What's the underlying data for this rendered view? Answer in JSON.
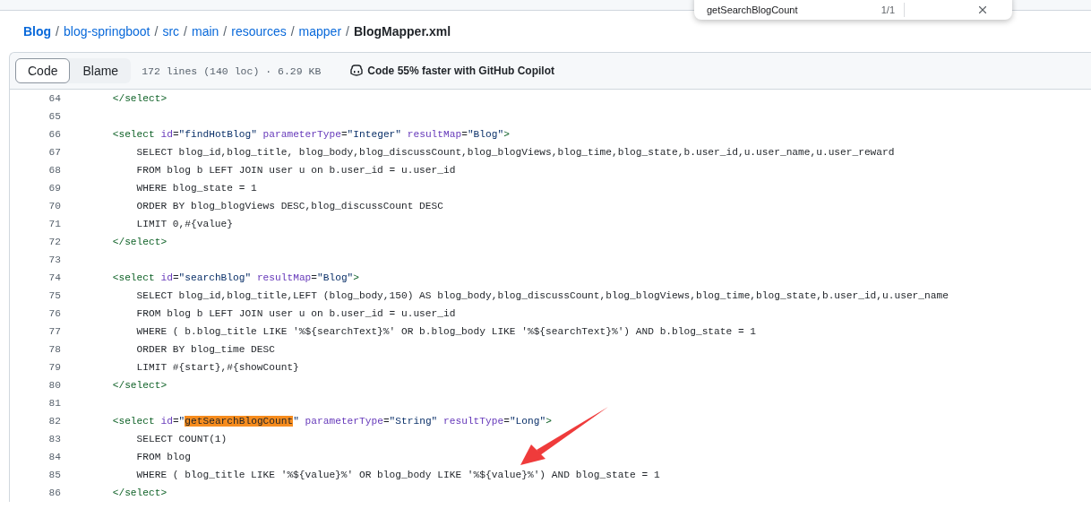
{
  "find_bar": {
    "query": "getSearchBlogCount",
    "count": "1/1"
  },
  "breadcrumb": [
    {
      "label": "Blog",
      "kind": "repo"
    },
    {
      "separator": "/",
      "label": "blog-springboot",
      "kind": "dir"
    },
    {
      "separator": "/",
      "label": "src",
      "kind": "dir"
    },
    {
      "separator": "/",
      "label": "main",
      "kind": "dir"
    },
    {
      "separator": "/",
      "label": "resources",
      "kind": "dir"
    },
    {
      "separator": "/",
      "label": "mapper",
      "kind": "dir"
    },
    {
      "separator": "/",
      "label": "BlogMapper.xml",
      "kind": "file"
    }
  ],
  "view_tabs": [
    {
      "label": "Code",
      "selected": true
    },
    {
      "label": "Blame",
      "selected": false
    }
  ],
  "file_info": "172 lines (140 loc) · 6.29 KB",
  "copilot_promo": "Code 55% faster with GitHub Copilot",
  "lines": [
    {
      "number": "64",
      "segments": [
        {
          "kind": "tag",
          "text": "        </select>"
        }
      ]
    },
    {
      "number": "65"
    },
    {
      "number": "66",
      "segments": [
        {
          "kind": "tag",
          "text": "        <select"
        },
        {
          "kind": "attr",
          "text": " id"
        },
        {
          "kind": "plain",
          "text": "="
        },
        {
          "kind": "string",
          "text": "\"findHotBlog\""
        },
        {
          "kind": "attr",
          "text": " parameterType"
        },
        {
          "kind": "plain",
          "text": "="
        },
        {
          "kind": "string",
          "text": "\"Integer\""
        },
        {
          "kind": "attr",
          "text": " resultMap"
        },
        {
          "kind": "plain",
          "text": "="
        },
        {
          "kind": "string",
          "text": "\"Blog\""
        },
        {
          "kind": "tag",
          "text": ">"
        }
      ]
    },
    {
      "number": "67",
      "segments": [
        {
          "kind": "plain",
          "text": "            SELECT blog_id,blog_title, blog_body,blog_discussCount,blog_blogViews,blog_time,blog_state,b.user_id,u.user_name,u.user_reward"
        }
      ]
    },
    {
      "number": "68",
      "segments": [
        {
          "kind": "plain",
          "text": "            FROM blog b LEFT JOIN user u on b.user_id = u.user_id"
        }
      ]
    },
    {
      "number": "69",
      "segments": [
        {
          "kind": "plain",
          "text": "            WHERE blog_state = 1"
        }
      ]
    },
    {
      "number": "70",
      "segments": [
        {
          "kind": "plain",
          "text": "            ORDER BY blog_blogViews DESC,blog_discussCount DESC"
        }
      ]
    },
    {
      "number": "71",
      "segments": [
        {
          "kind": "plain",
          "text": "            LIMIT 0,#{value}"
        }
      ]
    },
    {
      "number": "72",
      "segments": [
        {
          "kind": "tag",
          "text": "        </select>"
        }
      ]
    },
    {
      "number": "73"
    },
    {
      "number": "74",
      "segments": [
        {
          "kind": "tag",
          "text": "        <select"
        },
        {
          "kind": "attr",
          "text": " id"
        },
        {
          "kind": "plain",
          "text": "="
        },
        {
          "kind": "string",
          "text": "\"searchBlog\""
        },
        {
          "kind": "attr",
          "text": " resultMap"
        },
        {
          "kind": "plain",
          "text": "="
        },
        {
          "kind": "string",
          "text": "\"Blog\""
        },
        {
          "kind": "tag",
          "text": ">"
        }
      ]
    },
    {
      "number": "75",
      "segments": [
        {
          "kind": "plain",
          "text": "            SELECT blog_id,blog_title,LEFT (blog_body,150) AS blog_body,blog_discussCount,blog_blogViews,blog_time,blog_state,b.user_id,u.user_name"
        }
      ]
    },
    {
      "number": "76",
      "segments": [
        {
          "kind": "plain",
          "text": "            FROM blog b LEFT JOIN user u on b.user_id = u.user_id"
        }
      ]
    },
    {
      "number": "77",
      "segments": [
        {
          "kind": "plain",
          "text": "            WHERE ( b.blog_title LIKE '%${searchText}%' OR b.blog_body LIKE '%${searchText}%') AND b.blog_state = 1"
        }
      ]
    },
    {
      "number": "78",
      "segments": [
        {
          "kind": "plain",
          "text": "            ORDER BY blog_time DESC"
        }
      ]
    },
    {
      "number": "79",
      "segments": [
        {
          "kind": "plain",
          "text": "            LIMIT #{start},#{showCount}"
        }
      ]
    },
    {
      "number": "80",
      "segments": [
        {
          "kind": "tag",
          "text": "        </select>"
        }
      ]
    },
    {
      "number": "81"
    },
    {
      "number": "82",
      "segments": [
        {
          "kind": "tag",
          "text": "        <select"
        },
        {
          "kind": "attr",
          "text": " id"
        },
        {
          "kind": "plain",
          "text": "="
        },
        {
          "kind": "string",
          "text": "\""
        },
        {
          "kind": "match",
          "text": "getSearchBlogCount"
        },
        {
          "kind": "string",
          "text": "\""
        },
        {
          "kind": "attr",
          "text": " parameterType"
        },
        {
          "kind": "plain",
          "text": "="
        },
        {
          "kind": "string",
          "text": "\"String\""
        },
        {
          "kind": "attr",
          "text": " resultType"
        },
        {
          "kind": "plain",
          "text": "="
        },
        {
          "kind": "string",
          "text": "\"Long\""
        },
        {
          "kind": "tag",
          "text": ">"
        }
      ]
    },
    {
      "number": "83",
      "segments": [
        {
          "kind": "plain",
          "text": "            SELECT COUNT(1)"
        }
      ]
    },
    {
      "number": "84",
      "segments": [
        {
          "kind": "plain",
          "text": "            FROM blog"
        }
      ]
    },
    {
      "number": "85",
      "segments": [
        {
          "kind": "plain",
          "text": "            WHERE ( blog_title LIKE '%${value}%' OR blog_body LIKE '%${value}%') AND blog_state = 1"
        }
      ]
    },
    {
      "number": "86",
      "segments": [
        {
          "kind": "tag",
          "text": "        </select>"
        }
      ]
    }
  ]
}
